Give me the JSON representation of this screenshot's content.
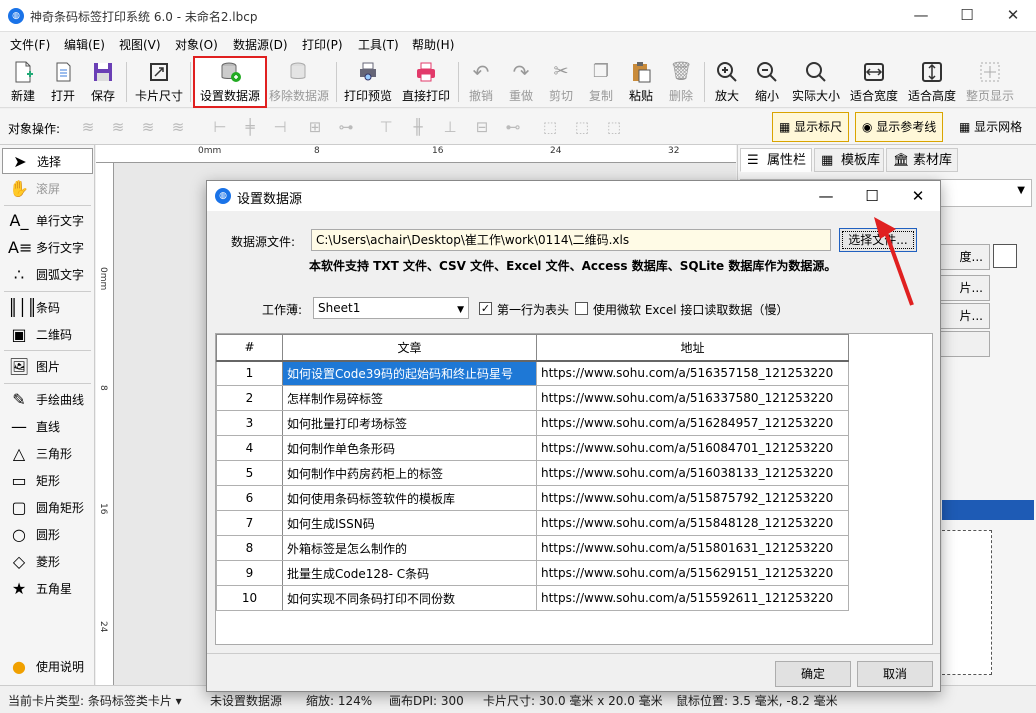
{
  "app": {
    "title": "神奇条码标签打印系统 6.0 - 未命名2.lbcp",
    "icon_glyph": "◍"
  },
  "window_controls": {
    "minimize": "—",
    "maximize": "☐",
    "close": "✕"
  },
  "menu": [
    "文件(F)",
    "编辑(E)",
    "视图(V)",
    "对象(O)",
    "数据源(D)",
    "打印(P)",
    "工具(T)",
    "帮助(H)"
  ],
  "toolbar": {
    "new": "新建",
    "open": "打开",
    "save": "保存",
    "card_size": "卡片尺寸",
    "set_datasource": "设置数据源",
    "remove_datasource": "移除数据源",
    "print_preview": "打印预览",
    "direct_print": "直接打印",
    "undo": "撤销",
    "redo": "重做",
    "cut": "剪切",
    "copy": "复制",
    "paste": "粘贴",
    "delete": "删除",
    "zoom_in": "放大",
    "zoom_out": "缩小",
    "actual_size": "实际大小",
    "fit_width": "适合宽度",
    "fit_height": "适合高度",
    "fit_page": "整页显示"
  },
  "objbar": {
    "label": "对象操作:",
    "show_ruler": "显示标尺",
    "show_guides": "显示参考线",
    "show_grid": "显示网格"
  },
  "tools": {
    "select": "选择",
    "pan": "滚屏",
    "single_text": "单行文字",
    "multi_text": "多行文字",
    "arc_text": "圆弧文字",
    "barcode": "条码",
    "qrcode": "二维码",
    "image": "图片",
    "freehand": "手绘曲线",
    "line": "直线",
    "triangle": "三角形",
    "rect": "矩形",
    "round_rect": "圆角矩形",
    "ellipse": "圆形",
    "diamond": "菱形",
    "star": "五角星",
    "help": "使用说明"
  },
  "ruler": {
    "h_ticks": [
      "0mm",
      "8",
      "16",
      "24",
      "32"
    ],
    "v_ticks": [
      "0mm",
      "8",
      "16",
      "24"
    ]
  },
  "right_panel": {
    "tabs": [
      "属性栏",
      "模板库",
      "素材库"
    ],
    "btn_partial_1": "度...",
    "btn_partial_2": "片...",
    "btn_partial_3": "片..."
  },
  "dialog": {
    "title": "设置数据源",
    "file_label": "数据源文件:",
    "file_path": "C:\\Users\\achair\\Desktop\\崔工作\\work\\0114\\二维码.xls",
    "choose_button": "选择文件...",
    "note": "本软件支持 TXT 文件、CSV 文件、Excel 文件、Access 数据库、SQLite 数据库作为数据源。",
    "sheet_label": "工作薄:",
    "sheet_value": "Sheet1",
    "first_row_header": "第一行为表头",
    "first_row_header_checked": true,
    "use_ms_excel": "使用微软 Excel 接口读取数据（慢）",
    "use_ms_excel_checked": false,
    "columns": [
      "#",
      "文章",
      "地址"
    ],
    "rows": [
      [
        "1",
        "如何设置Code39码的起始码和终止码星号",
        "https://www.sohu.com/a/516357158_121253220"
      ],
      [
        "2",
        "怎样制作易碎标签",
        "https://www.sohu.com/a/516337580_121253220"
      ],
      [
        "3",
        "如何批量打印考场标签",
        "https://www.sohu.com/a/516284957_121253220"
      ],
      [
        "4",
        "如何制作单色条形码",
        "https://www.sohu.com/a/516084701_121253220"
      ],
      [
        "5",
        "如何制作中药房药柜上的标签",
        "https://www.sohu.com/a/516038133_121253220"
      ],
      [
        "6",
        "如何使用条码标签软件的模板库",
        "https://www.sohu.com/a/515875792_121253220"
      ],
      [
        "7",
        "如何生成ISSN码",
        "https://www.sohu.com/a/515848128_121253220"
      ],
      [
        "8",
        "外箱标签是怎么制作的",
        "https://www.sohu.com/a/515801631_121253220"
      ],
      [
        "9",
        "批量生成Code128- C条码",
        "https://www.sohu.com/a/515629151_121253220"
      ],
      [
        "10",
        "如何实现不同条码打印不同份数",
        "https://www.sohu.com/a/515592611_121253220"
      ]
    ],
    "ok": "确定",
    "cancel": "取消"
  },
  "status": {
    "card_type": "当前卡片类型:  条码标签类卡片 ▾",
    "datasource": "未设置数据源",
    "zoom": "缩放: 124%",
    "dpi": "画布DPI:  300",
    "card_size": "卡片尺寸: 30.0 毫米 x 20.0 毫米",
    "mouse_pos": "鼠标位置: 3.5 毫米, -8.2 毫米"
  },
  "colors": {
    "accent": "#1e78d6",
    "highlight": "#e02020"
  }
}
